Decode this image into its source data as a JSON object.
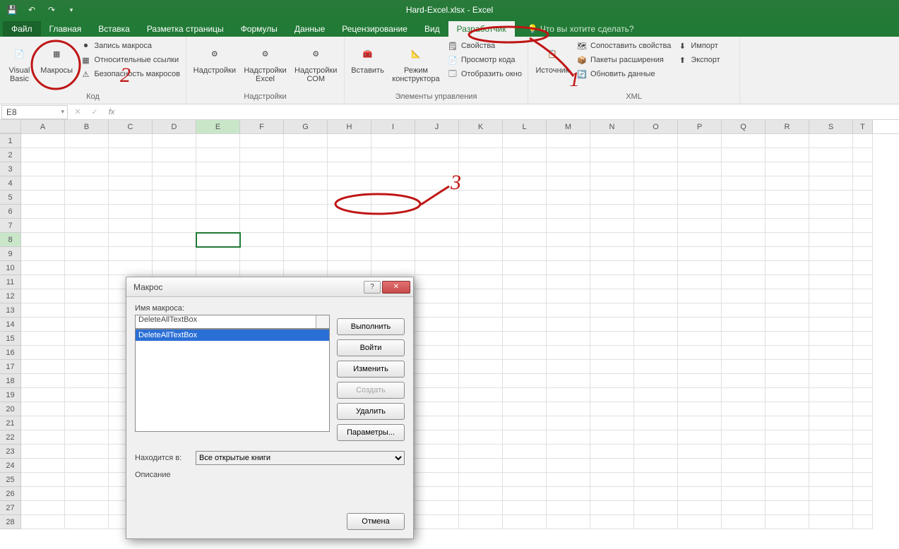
{
  "app": {
    "title": "Hard-Excel.xlsx - Excel"
  },
  "tabs": {
    "file": "Файл",
    "items": [
      "Главная",
      "Вставка",
      "Разметка страницы",
      "Формулы",
      "Данные",
      "Рецензирование",
      "Вид",
      "Разработчик"
    ],
    "active": "Разработчик",
    "tellme": "Что вы хотите сделать?"
  },
  "ribbon": {
    "code": {
      "vb": "Visual\nBasic",
      "macros": "Макросы",
      "rec": "Запись макроса",
      "rel": "Относительные ссылки",
      "sec": "Безопасность макросов",
      "label": "Код"
    },
    "addins": {
      "a1": "Надстройки",
      "a2": "Надстройки\nExcel",
      "a3": "Надстройки\nCOM",
      "label": "Надстройки"
    },
    "controls": {
      "insert": "Вставить",
      "design": "Режим\nконструктора",
      "props": "Свойства",
      "viewcode": "Просмотр кода",
      "showwin": "Отобразить окно",
      "label": "Элементы управления"
    },
    "xml": {
      "source": "Источник",
      "mapprops": "Сопоставить свойства",
      "expansion": "Пакеты расширения",
      "refresh": "Обновить данные",
      "import": "Импорт",
      "export": "Экспорт",
      "label": "XML"
    }
  },
  "namebox": "E8",
  "columns": [
    "A",
    "B",
    "C",
    "D",
    "E",
    "F",
    "G",
    "H",
    "I",
    "J",
    "K",
    "L",
    "M",
    "N",
    "O",
    "P",
    "Q",
    "R",
    "S",
    "T"
  ],
  "rows": [
    1,
    2,
    3,
    4,
    5,
    6,
    7,
    8,
    9,
    10,
    11,
    12,
    13,
    14,
    15,
    16,
    17,
    18,
    19,
    20,
    21,
    22,
    23,
    24,
    25,
    26,
    27,
    28
  ],
  "active_col": "E",
  "active_row": 8,
  "dialog": {
    "title": "Макрос",
    "name_label": "Имя макроса:",
    "name_value": "DeleteAllTextBox",
    "list": [
      "DeleteAllTextBox"
    ],
    "run": "Выполнить",
    "step": "Войти",
    "edit": "Изменить",
    "create": "Создать",
    "delete": "Удалить",
    "params": "Параметры...",
    "location_label": "Находится в:",
    "location_value": "Все открытые книги",
    "desc_label": "Описание",
    "cancel": "Отмена"
  },
  "anno": {
    "n1": "1",
    "n2": "2",
    "n3": "3"
  }
}
